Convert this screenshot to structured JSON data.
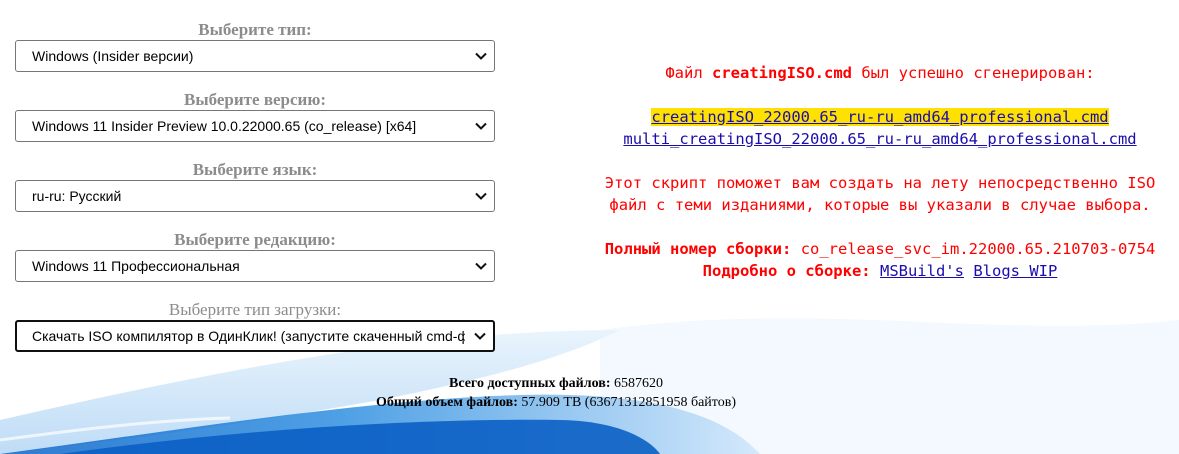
{
  "form": {
    "type": {
      "label": "Выберите тип:",
      "value": "Windows (Insider версии)"
    },
    "version": {
      "label": "Выберите версию:",
      "value": "Windows 11 Insider Preview 10.0.22000.65 (co_release) [x64]"
    },
    "language": {
      "label": "Выберите язык:",
      "value": "ru-ru: Русский"
    },
    "edition": {
      "label": "Выберите редакцию:",
      "value": "Windows 11 Профессиональная"
    },
    "download": {
      "label": "Выберите тип загрузки:",
      "value": "Скачать ISO компилятор в ОдинКлик! (запустите скаченный cmd-фа"
    }
  },
  "result": {
    "prefix": "Файл ",
    "filename": "creatingISO.cmd",
    "suffix": " был успешно сгенерирован:",
    "link1": "creatingISO_22000.65_ru-ru_amd64_professional.cmd",
    "link2": "multi_creatingISO_22000.65_ru-ru_amd64_professional.cmd",
    "description": "Этот скрипт поможет вам создать на лету непосредственно ISO файл с теми изданиями, которые вы указали в случае выбора.",
    "build_label": "Полный номер сборки:",
    "build_value": "co_release_svc_im.22000.65.210703-0754",
    "details_label": "Подробно о сборке:",
    "details_link1": "MSBuild's",
    "details_link2": "Blogs WIP"
  },
  "stats": {
    "total_files_label": "Всего доступных файлов:",
    "total_files_value": "6587620",
    "total_size_label": "Общий объем файлов:",
    "total_size_value": "57.909 TB (63671312851958 байтов)"
  },
  "colors": {
    "accent_red": "#ff0000",
    "link_blue": "#1a0dab",
    "highlight_yellow": "#ffe100",
    "label_gray": "#8c8c8c",
    "wave_blue": "#2f8fe0"
  },
  "icons": {
    "select_arrow": "chevron-down-icon"
  }
}
